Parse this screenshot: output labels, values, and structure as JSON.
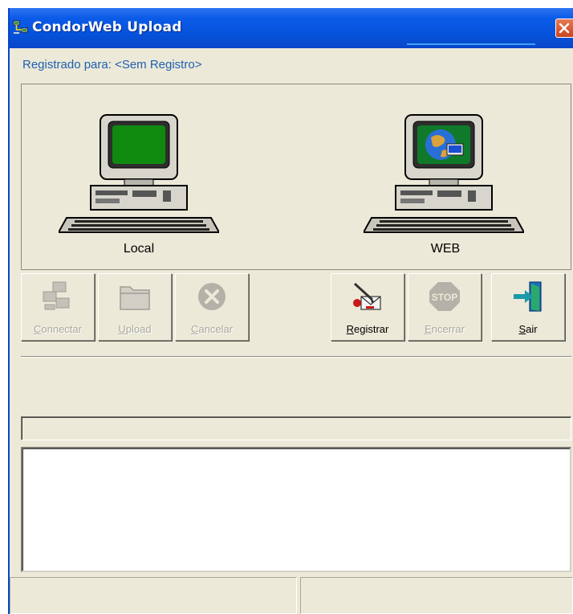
{
  "window": {
    "title": "CondorWeb Upload",
    "title_icon": "network-icon",
    "close_icon": "close-icon"
  },
  "registered_label": "Registrado para: <Sem Registro>",
  "computers": {
    "local": {
      "label": "Local",
      "icon": "computer-green-screen-icon"
    },
    "web": {
      "label": "WEB",
      "icon": "computer-globe-screen-icon"
    }
  },
  "toolbar": {
    "buttons": [
      {
        "id": "connect",
        "label": "Connectar",
        "mnemonic": "C",
        "rest": "onnectar",
        "icon": "network-computers-icon",
        "enabled": false
      },
      {
        "id": "upload",
        "label": "Upload",
        "mnemonic": "U",
        "rest": "pload",
        "icon": "folder-icon",
        "enabled": false
      },
      {
        "id": "cancel",
        "label": "Cancelar",
        "mnemonic": "C",
        "rest": "ancelar",
        "icon": "cancel-x-icon",
        "enabled": false
      },
      {
        "id": "register",
        "label": "Registrar",
        "mnemonic": "R",
        "rest": "egistrar",
        "icon": "register-pen-icon",
        "enabled": true
      },
      {
        "id": "stop",
        "label": "Encerrar",
        "mnemonic": "E",
        "rest": "ncerrar",
        "icon": "stop-sign-icon",
        "enabled": false
      },
      {
        "id": "exit",
        "label": "Sair",
        "mnemonic": "S",
        "rest": "air",
        "icon": "exit-door-icon",
        "enabled": true
      }
    ]
  },
  "progress": {
    "value": 0
  },
  "log_text": "",
  "status_panes": [
    "",
    ""
  ],
  "colors": {
    "titlebar": "#0551d8",
    "window_bg": "#ece9d8",
    "registered_text": "#1f5faf",
    "close_button": "#c9441e"
  }
}
